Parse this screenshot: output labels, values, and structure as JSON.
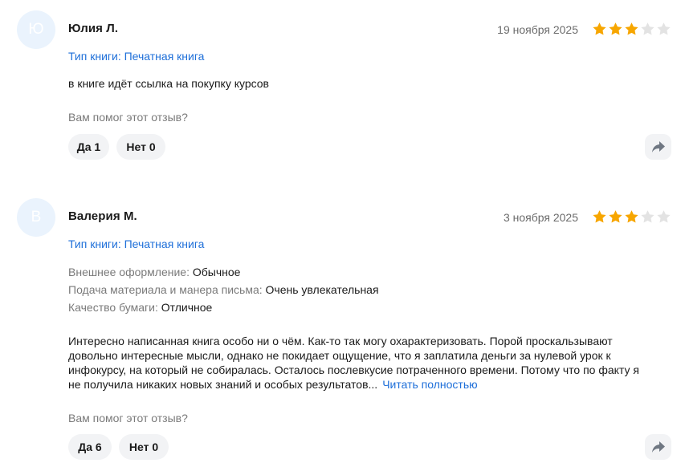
{
  "reviews": [
    {
      "avatar_letter": "Ю",
      "author": "Юлия Л.",
      "date": "19 ноября 2025",
      "rating": 3,
      "rating_max": 5,
      "book_type": "Тип книги: Печатная книга",
      "text": "в книге идёт ссылка на покупку курсов",
      "helpful_prompt": "Вам помог этот отзыв?",
      "yes_label": "Да 1",
      "no_label": "Нет 0",
      "share_icon": "share-arrow-icon"
    },
    {
      "avatar_letter": "В",
      "author": "Валерия М.",
      "date": "3 ноября 2025",
      "rating": 3,
      "rating_max": 5,
      "book_type": "Тип книги: Печатная книга",
      "attributes": [
        {
          "key": "Внешнее оформление:",
          "value": "Обычное"
        },
        {
          "key": "Подача материала и манера письма:",
          "value": "Очень увлекательная"
        },
        {
          "key": "Качество бумаги:",
          "value": "Отличное"
        }
      ],
      "text_lines": [
        "Интересно написанная книга особо ни о чём. Как-то так могу охарактеризовать. Порой проскальзывают",
        "довольно интересные мысли, однако не покидает ощущение, что я заплатила деньги за нулевой урок к",
        "инфокурсу, на который не собиралась. Осталось послевкусие потраченного времени. Потому что по факту я",
        "не получила никаких новых знаний и особых результатов..."
      ],
      "read_more": "Читать полностью",
      "helpful_prompt": "Вам помог этот отзыв?",
      "yes_label": "Да 6",
      "no_label": "Нет 0",
      "share_icon": "share-arrow-icon"
    }
  ],
  "colors": {
    "star_filled": "#f7a600",
    "star_empty": "#e3e3e3",
    "link": "#1e6fd9",
    "avatar_bg": "#eaf3fd"
  }
}
